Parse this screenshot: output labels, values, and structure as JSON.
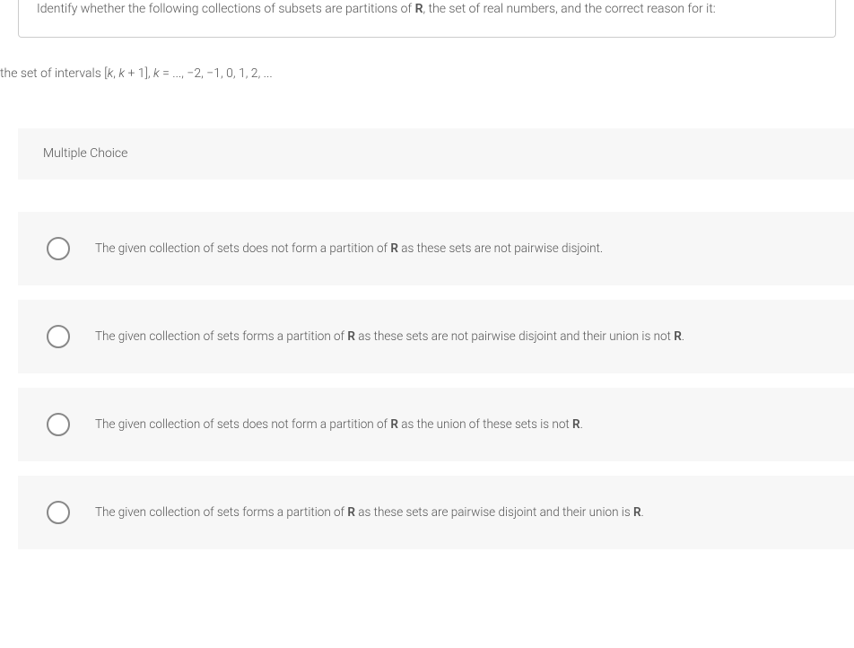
{
  "question": {
    "prefix": "Identify whether the following collections of subsets are partitions of ",
    "bold1": "R",
    "suffix": ", the set of real numbers, and the correct reason for it:"
  },
  "subquestion": {
    "prefix": "the set of intervals [",
    "italic1": "k",
    "mid1": ", ",
    "italic2": "k",
    "mid2": " + 1], ",
    "italic3": "k",
    "suffix": " = ..., −2, −1, 0, 1, 2, ..."
  },
  "mc_label": "Multiple Choice",
  "options": [
    {
      "pre": "The given collection of sets does not form a partition of ",
      "bold": "R",
      "post": " as these sets are not pairwise disjoint."
    },
    {
      "pre": "The given collection of sets forms a partition of ",
      "bold": "R",
      "post": " as these sets are not pairwise disjoint and their union is not ",
      "bold2": "R",
      "post2": "."
    },
    {
      "pre": "The given collection of sets does not form a partition of ",
      "bold": "R",
      "post": " as the union of these sets is not ",
      "bold2": "R",
      "post2": "."
    },
    {
      "pre": "The given collection of sets forms a partition of ",
      "bold": "R",
      "post": " as these sets are pairwise disjoint and their union is ",
      "bold2": "R",
      "post2": "."
    }
  ]
}
